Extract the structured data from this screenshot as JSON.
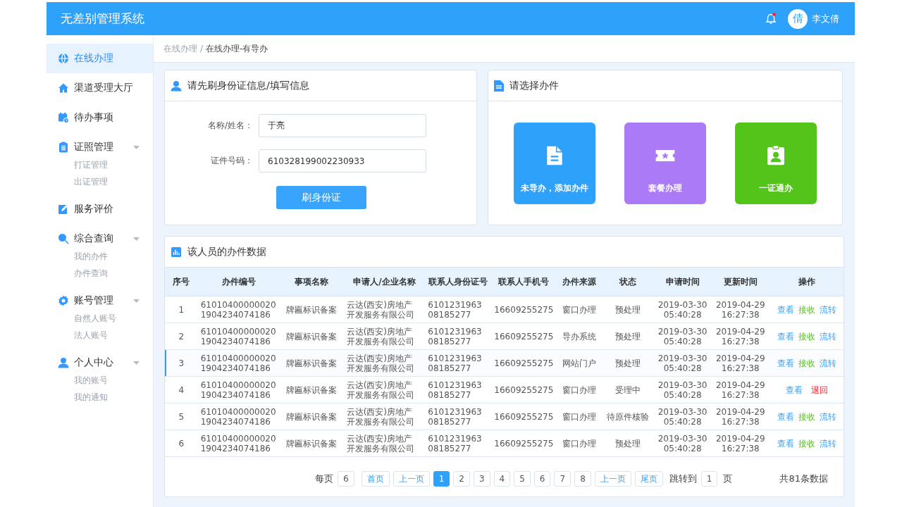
{
  "header": {
    "title": "无差别管理系统",
    "user": {
      "avatar_text": "倩",
      "name": "李文倩"
    }
  },
  "sidebar": {
    "items": [
      {
        "kind": "globe",
        "label": "在线办理",
        "selected": true
      },
      {
        "kind": "home",
        "label": "渠道受理大厅",
        "selected": false
      },
      {
        "kind": "calendar",
        "label": "待办事项",
        "selected": false
      },
      {
        "kind": "clipboard",
        "label": "证照管理",
        "selected": false,
        "expanded": true,
        "children": [
          {
            "label": "打证管理"
          },
          {
            "label": "出证管理"
          }
        ]
      },
      {
        "kind": "edit",
        "label": "服务评价",
        "selected": false
      },
      {
        "kind": "search",
        "label": "综合查询",
        "selected": false,
        "expanded": true,
        "children": [
          {
            "label": "我的办件"
          },
          {
            "label": "办件查询"
          }
        ]
      },
      {
        "kind": "gear",
        "label": "账号管理",
        "selected": false,
        "expanded": true,
        "children": [
          {
            "label": "自然人账号"
          },
          {
            "label": "法人账号"
          }
        ]
      },
      {
        "kind": "user",
        "label": "个人中心",
        "selected": false,
        "expanded": true,
        "children": [
          {
            "label": "我的账号"
          },
          {
            "label": "我的通知"
          }
        ]
      }
    ]
  },
  "breadcrumb": {
    "items": [
      "在线办理",
      "在线办理-有导办"
    ],
    "separator": "/"
  },
  "id_panel": {
    "title": "请先刷身份证信息/填写信息",
    "fields": [
      {
        "label": "名称/姓名：",
        "value": "于亮"
      },
      {
        "label": "证件号码：",
        "value": "610328199002230933"
      }
    ],
    "button": "刷身份证"
  },
  "choose_panel": {
    "title": "请选择办件",
    "tiles": [
      {
        "kind": "document",
        "label": "未导办，添加办件",
        "color": "#2ea1fb"
      },
      {
        "kind": "ticket",
        "label": "套餐办理",
        "color": "#ab7bf7"
      },
      {
        "kind": "badge",
        "label": "一证通办",
        "color": "#52c41a"
      }
    ]
  },
  "table_panel": {
    "title": "该人员的办件数据",
    "columns": [
      "序号",
      "办件编号",
      "事项名称",
      "申请人/企业名称",
      "联系人身份证号",
      "联系人手机号",
      "办件来源",
      "状态",
      "申请时间",
      "更新时间",
      "操作"
    ],
    "rows": [
      {
        "selected": false,
        "cells": [
          "1",
          "61010400000020\n1904234074186",
          "牌匾标识备案",
          "云达(西安)房地产开发服务有限公司",
          "6101231963\n08185277",
          "16609255275",
          "窗口办理",
          "预处理",
          "2019-03-30\n05:40:28",
          "2019-04-29\n16:27:38"
        ],
        "actions": [
          {
            "kind": "view",
            "label": "查看"
          },
          {
            "kind": "accept",
            "label": "接收"
          },
          {
            "kind": "transfer",
            "label": "流转"
          }
        ]
      },
      {
        "selected": false,
        "cells": [
          "2",
          "61010400000020\n1904234074186",
          "牌匾标识备案",
          "云达(西安)房地产开发服务有限公司",
          "6101231963\n08185277",
          "16609255275",
          "导办系统",
          "预处理",
          "2019-03-30\n05:40:28",
          "2019-04-29\n16:27:38"
        ],
        "actions": [
          {
            "kind": "view",
            "label": "查看"
          },
          {
            "kind": "accept",
            "label": "接收"
          },
          {
            "kind": "transfer",
            "label": "流转"
          }
        ]
      },
      {
        "selected": true,
        "cells": [
          "3",
          "61010400000020\n1904234074186",
          "牌匾标识备案",
          "云达(西安)房地产开发服务有限公司",
          "6101231963\n08185277",
          "16609255275",
          "网站门户",
          "预处理",
          "2019-03-30\n05:40:28",
          "2019-04-29\n16:27:38"
        ],
        "actions": [
          {
            "kind": "view",
            "label": "查看"
          },
          {
            "kind": "accept",
            "label": "接收"
          },
          {
            "kind": "transfer",
            "label": "流转"
          }
        ]
      },
      {
        "selected": false,
        "cells": [
          "4",
          "61010400000020\n1904234074186",
          "牌匾标识备案",
          "云达(西安)房地产开发服务有限公司",
          "6101231963\n08185277",
          "16609255275",
          "窗口办理",
          "受理中",
          "2019-03-30\n05:40:28",
          "2019-04-29\n16:27:38"
        ],
        "actions": [
          {
            "kind": "view",
            "label": "查看"
          },
          {
            "kind": "return",
            "label": "退回"
          }
        ]
      },
      {
        "selected": false,
        "cells": [
          "5",
          "61010400000020\n1904234074186",
          "牌匾标识备案",
          "云达(西安)房地产开发服务有限公司",
          "6101231963\n08185277",
          "16609255275",
          "窗口办理",
          "待原件核验",
          "2019-03-30\n05:40:28",
          "2019-04-29\n16:27:38"
        ],
        "actions": [
          {
            "kind": "view",
            "label": "查看"
          },
          {
            "kind": "accept",
            "label": "接收"
          },
          {
            "kind": "transfer",
            "label": "流转"
          }
        ]
      },
      {
        "selected": false,
        "cells": [
          "6",
          "61010400000020\n1904234074186",
          "牌匾标识备案",
          "云达(西安)房地产开发服务有限公司",
          "6101231963\n08185277",
          "16609255275",
          "窗口办理",
          "预处理",
          "2019-03-30\n05:40:28",
          "2019-04-29\n16:27:38"
        ],
        "actions": [
          {
            "kind": "view",
            "label": "查看"
          },
          {
            "kind": "accept",
            "label": "接收"
          },
          {
            "kind": "transfer",
            "label": "流转"
          }
        ]
      }
    ],
    "pagination": {
      "per_page_label": "每页",
      "per_page": "6",
      "first": "首页",
      "prev": "上一页",
      "pages": [
        {
          "label": "1",
          "selected": true
        },
        {
          "label": "2",
          "selected": false
        },
        {
          "label": "3",
          "selected": false
        },
        {
          "label": "4",
          "selected": false
        },
        {
          "label": "5",
          "selected": false
        },
        {
          "label": "6",
          "selected": false
        },
        {
          "label": "7",
          "selected": false
        },
        {
          "label": "8",
          "selected": false
        }
      ],
      "next": "上一页",
      "last": "尾页",
      "jump_label": "跳转到",
      "jump_value": "1",
      "page_unit": "页",
      "total": "共81条数据"
    }
  }
}
